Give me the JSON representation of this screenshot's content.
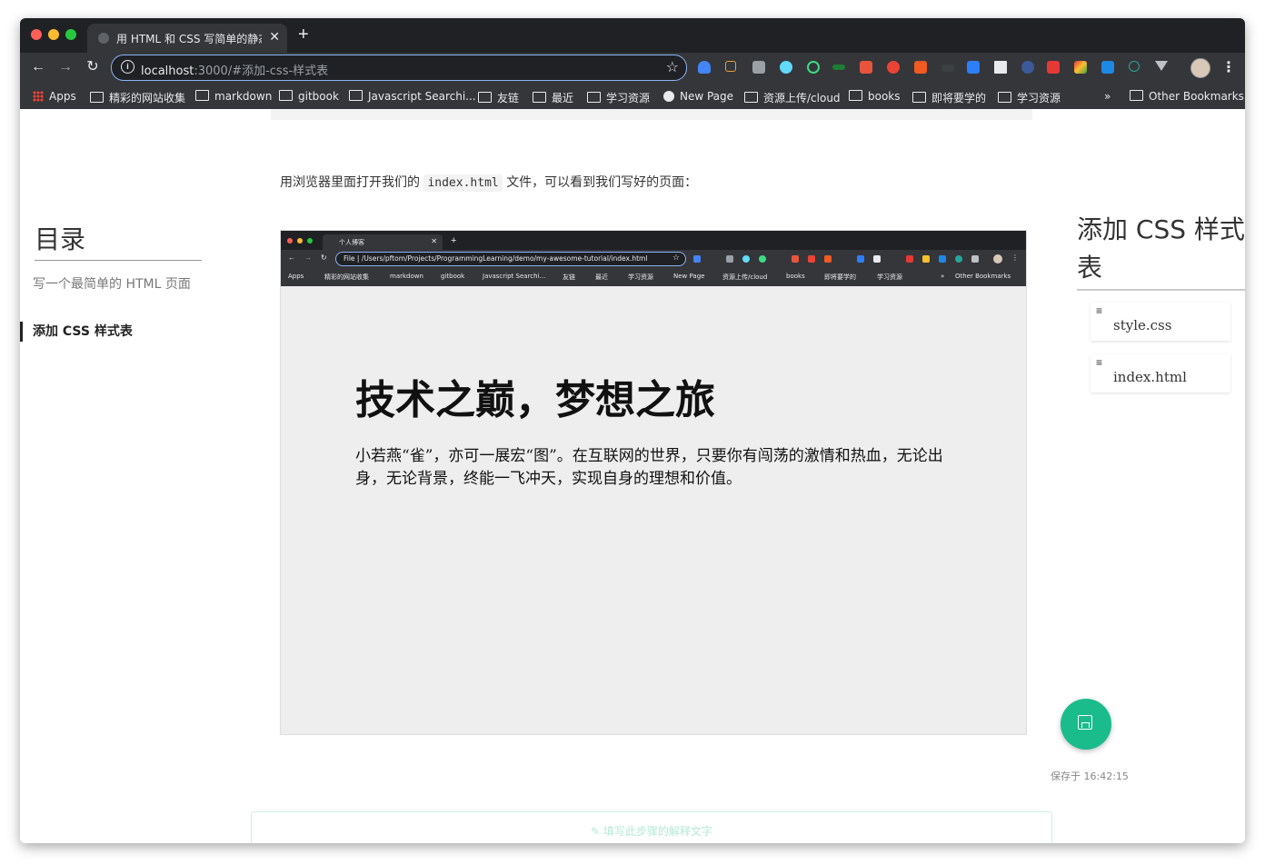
{
  "browser": {
    "tab_title": "用 HTML 和 CSS 写简单的静态",
    "tab_close": "✕",
    "new_tab": "+",
    "url_host": "localhost",
    "url_path": ":3000/#添加-css-样式表",
    "star": "☆",
    "back": "←",
    "forward": "→",
    "reload": "↻",
    "menu": "⋮",
    "bookmarks": [
      {
        "label": "Apps",
        "icon": "apps-grid-icon"
      },
      {
        "label": "精彩的网站收集",
        "icon": "folder-icon"
      },
      {
        "label": "markdown",
        "icon": "folder-icon"
      },
      {
        "label": "gitbook",
        "icon": "folder-icon"
      },
      {
        "label": "Javascript Searchi...",
        "icon": "folder-icon"
      },
      {
        "label": "友链",
        "icon": "folder-icon"
      },
      {
        "label": "最近",
        "icon": "folder-icon"
      },
      {
        "label": "学习资源",
        "icon": "folder-icon"
      },
      {
        "label": "New Page",
        "icon": "github-icon"
      },
      {
        "label": "资源上传/cloud",
        "icon": "folder-icon"
      },
      {
        "label": "books",
        "icon": "folder-icon"
      },
      {
        "label": "即将要学的",
        "icon": "folder-icon"
      },
      {
        "label": "学习资源",
        "icon": "folder-icon"
      }
    ],
    "bookmarks_overflow": "»",
    "other_bookmarks": "Other Bookmarks"
  },
  "page": {
    "intro_before": "用浏览器里面打开我们的",
    "intro_code": "index.html",
    "intro_after": "文件，可以看到我们写好的页面：",
    "toc": {
      "title": "目录",
      "items": [
        {
          "label": "写一个最简单的 HTML 页面",
          "active": false
        },
        {
          "label": "添加 CSS 样式表",
          "active": true
        }
      ]
    },
    "screenshot": {
      "tab_title": "个人博客",
      "tab_close": "✕",
      "new_tab": "+",
      "url": "File  |  /Users/pftom/Projects/ProgrammingLearning/demo/my-awesome-tutorial/index.html",
      "bookmarks": [
        "Apps",
        "精彩的网站收集",
        "markdown",
        "gitbook",
        "Javascript Searchi...",
        "友链",
        "最近",
        "学习资源",
        "New Page",
        "资源上传/cloud",
        "books",
        "即将要学的",
        "学习资源",
        "»",
        "Other Bookmarks"
      ],
      "heading": "技术之巅，梦想之旅",
      "paragraph": "小若燕“雀”，亦可一展宏“图”。在互联网的世界，只要你有闯荡的激情和热血，无论出身，无论背景，终能一飞冲天，实现自身的理想和价值。"
    },
    "right_toc": {
      "title": "添加 CSS 样式表",
      "files": [
        {
          "icon": "≡",
          "name": "style.css"
        },
        {
          "icon": "≡",
          "name": "index.html"
        }
      ]
    },
    "saved_text": "保存于 16:42:15",
    "explain_placeholder": "✎  填写此步骤的解释文字",
    "accent_color": "#1abc8c"
  }
}
